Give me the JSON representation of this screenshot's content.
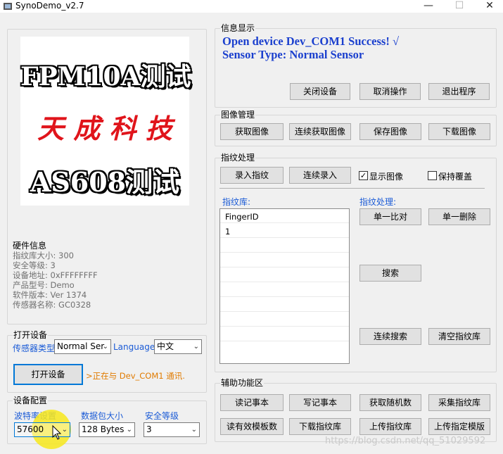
{
  "window": {
    "title": "SynoDemo_v2.7",
    "minimize": "—",
    "maximize": "☐",
    "close": "✕"
  },
  "logo": {
    "line1": "FPM10A测试",
    "line2": "天 成 科 技",
    "line3": "AS608测试"
  },
  "hardware": {
    "label": "硬件信息",
    "lines": [
      "指纹库大小: 300",
      "安全等级: 3",
      "设备地址: 0xFFFFFFFF",
      "产品型号:  Demo",
      "软件版本: Ver 1374",
      "传感器名称: GC0328"
    ]
  },
  "open_device": {
    "label": "打开设备",
    "sensor_type_label": "传感器类型",
    "sensor_type_value": "Normal Ser",
    "language_label": "Language",
    "language_value": "中文",
    "open_button": "打开设备",
    "status": ">正在与 Dev_COM1 通讯."
  },
  "device_config": {
    "label": "设备配置",
    "baud_label": "波特率设置",
    "baud_value": "57600",
    "packet_label": "数据包大小",
    "packet_value": "128 Bytes",
    "security_label": "安全等级",
    "security_value": "3"
  },
  "info": {
    "label": "信息显示",
    "line1": "Open device Dev_COM1 Success! √",
    "line2": "Sensor Type: Normal Sensor",
    "buttons": [
      "关闭设备",
      "取消操作",
      "退出程序"
    ]
  },
  "image_mgmt": {
    "label": "图像管理",
    "buttons": [
      "获取图像",
      "连续获取图像",
      "保存图像",
      "下载图像"
    ]
  },
  "fingerprint": {
    "label": "指纹处理",
    "enroll": "录入指纹",
    "continuous_enroll": "连续录入",
    "show_image_label": "显示图像",
    "show_image_checked": true,
    "keep_overwrite_label": "保持覆盖",
    "keep_overwrite_checked": false,
    "library_label": "指纹库:",
    "process_label": "指纹处理:",
    "list_header": "FingerID",
    "list_items": [
      "1"
    ],
    "compare": "单一比对",
    "delete_one": "单一删除",
    "search": "搜索",
    "continuous_search": "连续搜索",
    "clear_library": "清空指纹库"
  },
  "aux": {
    "label": "辅助功能区",
    "row1": [
      "读记事本",
      "写记事本",
      "获取随机数",
      "采集指纹库"
    ],
    "row2": [
      "读有效模板数",
      "下载指纹库",
      "上传指纹库",
      "上传指定模版"
    ]
  },
  "watermark": "https://blog.csdn.net/qq_51029592",
  "colors": {
    "accent": "#0078d7",
    "label_blue": "#1b5bd6",
    "info_text": "#1a3fce",
    "status_orange": "#e07b00",
    "logo_red": "#e0141b",
    "cursor_highlight": "#f7e81b"
  }
}
